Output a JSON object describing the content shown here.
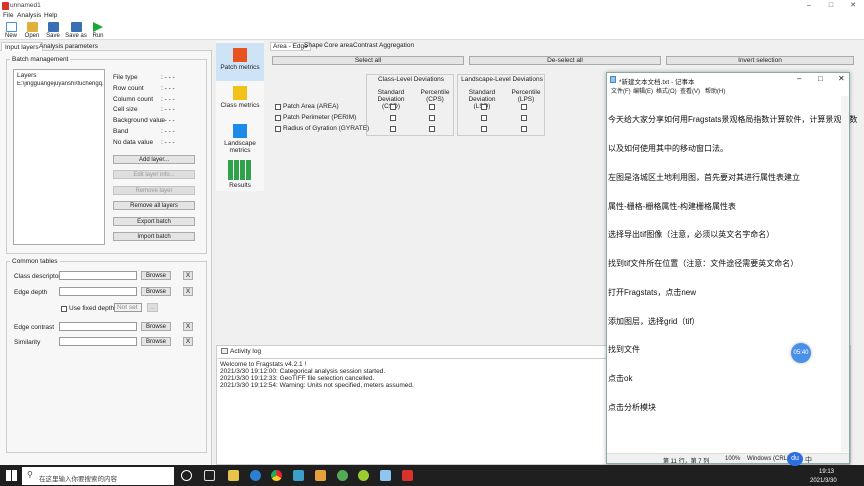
{
  "app": {
    "title": "unnamed1"
  },
  "menu": [
    "File",
    "Analysis",
    "Help"
  ],
  "toolbar": [
    {
      "label": "New",
      "color": "#4a90d9"
    },
    {
      "label": "Open",
      "color": "#e2b13c"
    },
    {
      "label": "Save",
      "color": "#3b6fb5"
    },
    {
      "label": "Save as",
      "color": "#3b6fb5"
    },
    {
      "label": "Run",
      "color": "#1fa83a"
    }
  ],
  "left_tabs": [
    "Input layers",
    "Analysis parameters"
  ],
  "batch": {
    "title": "Batch management",
    "layers_header": "Layers",
    "layer_path": "E:\\jingguangejuyanshi\\fuchengq...",
    "props": [
      {
        "k": "File type",
        "v": ": - - -"
      },
      {
        "k": "Row count",
        "v": ": - - -"
      },
      {
        "k": "Column count",
        "v": ": - - -"
      },
      {
        "k": "Cell size",
        "v": ": - - -"
      },
      {
        "k": "Background value",
        "v": ": - - -"
      },
      {
        "k": "Band",
        "v": ": - - -"
      },
      {
        "k": "No data value",
        "v": ": - - -"
      }
    ],
    "buttons": {
      "add": "Add layer...",
      "edit": "Edit layer info...",
      "remove": "Remove layer",
      "remove_all": "Remove all layers",
      "export": "Export batch",
      "import": "Import batch"
    }
  },
  "common": {
    "title": "Common tables",
    "class_desc": "Class descriptors",
    "edge_depth": "Edge depth",
    "fixed_depth": "Use fixed depth",
    "not_set": "Not set",
    "edge_contrast": "Edge contrast",
    "similarity": "Similarity",
    "browse": "Browse",
    "x": "X",
    "ellipsis": "..."
  },
  "sidebar": [
    "Patch metrics",
    "Class metrics",
    "Landscape metrics",
    "Results"
  ],
  "sidebar_colors": [
    "#e8521f",
    "#f2c21b",
    "#1e8ae8",
    "#2fa34a"
  ],
  "metric_tabs": [
    "Area - Edge",
    "Shape",
    "Core area",
    "Contrast",
    "Aggregation"
  ],
  "bigbuttons": [
    "Select all",
    "De-select all",
    "Invert selection"
  ],
  "class_dev": {
    "title": "Class-Level Deviations",
    "c1": "Standard Deviation  (CSD)",
    "c2": "Percentile (CPS)"
  },
  "land_dev": {
    "title": "Landscape-Level Deviations",
    "c1": "Standard Deviation  (LSD)",
    "c2": "Percentile (LPS)"
  },
  "metrics": [
    "Patch Area  (AREA)",
    "Patch Perimeter  (PERIM)",
    "Radius of Gyration  (GYRATE)"
  ],
  "log": {
    "title": "Activity log",
    "lines": [
      "Welcome to Fragstats v4.2.1 !",
      "2021/3/30 19:12:00: Categorical analysis session started.",
      "2021/3/30 19:12:33: GeoTIFF file selection cancelled.",
      "2021/3/30 19:12:54: Warning: Units not specified, meters assumed."
    ]
  },
  "notepad": {
    "title": "*新建文本文档.txt - 记事本",
    "menu": [
      "文件(F)",
      "编辑(E)",
      "格式(O)",
      "查看(V)",
      "帮助(H)"
    ],
    "lines": [
      "今天给大家分享如何用Fragstats景观格局指数计算软件，计算景观指数",
      "以及如何使用其中的移动窗口法。",
      "左图是洛城区土地利用图，首先要对其进行属性表建立",
      "属性-栅格-栅格属性-构建栅格属性表",
      "选择导出tif图像（注意，必须以英文名字命名）",
      "找到tif文件所在位置（注意：文件途径需要英文命名）",
      "打开Fragstats，点击new",
      "添加图层，选择grid（tif）",
      "找到文件",
      "点击ok",
      "点击分析模块"
    ],
    "status_pos": "第 11 行，第 7 列",
    "status_zoom": "100%",
    "status_enc": "Windows (CRLF)"
  },
  "timer": "05:40",
  "taskbar": {
    "search": "在这里输入你要搜索的内容",
    "time": "19:13",
    "date": "2021/3/30",
    "lang": "中",
    "du": "du"
  }
}
